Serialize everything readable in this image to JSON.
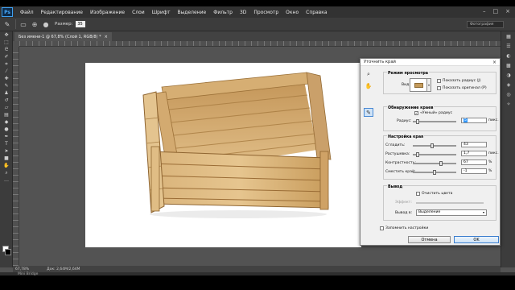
{
  "menubar": {
    "items": [
      "Файл",
      "Редактирование",
      "Изображение",
      "Слои",
      "Шрифт",
      "Выделение",
      "Фильтр",
      "3D",
      "Просмотр",
      "Окно",
      "Справка"
    ],
    "logo": "Ps"
  },
  "options_bar": {
    "size_label": "Размер:",
    "size_value": "35",
    "workspace": "Фотография"
  },
  "document": {
    "tab_title": "Без имени-1 @ 67,8% (Слой 1, RGB/8) *",
    "tab_close": "×"
  },
  "status_bar": {
    "zoom": "67,78%",
    "doc_info": "Док: 2,64M/2,64M",
    "mini_bridge": "Mini Bridge"
  },
  "dialog": {
    "title": "Уточнить край",
    "view_mode": {
      "group_title": "Режим просмотра",
      "view_label": "Вид:",
      "show_radius": "Показать радиус (J)",
      "show_original": "Показать оригинал (P)"
    },
    "edge_detection": {
      "group_title": "Обнаружение краев",
      "smart_radius": "«Умный» радиус",
      "smart_radius_checked": true,
      "radius_label": "Радиус:",
      "radius_value": "5",
      "radius_unit": "пикс.",
      "radius_fraction": 0.06
    },
    "adjust_edge": {
      "group_title": "Настройка края",
      "rows": [
        {
          "label": "Сгладить:",
          "value": "43",
          "unit": "",
          "fraction": 0.43
        },
        {
          "label": "Растушевка:",
          "value": "1,7",
          "unit": "пикс.",
          "fraction": 0.07
        },
        {
          "label": "Контрастность:",
          "value": "67",
          "unit": "%",
          "fraction": 0.67
        },
        {
          "label": "Сместить край:",
          "value": "-1",
          "unit": "%",
          "fraction": 0.49
        }
      ]
    },
    "output": {
      "group_title": "Вывод",
      "decontaminate": "Очистить цвета",
      "amount_label": "Эффект:",
      "output_to_label": "Вывод в:",
      "output_to_value": "Выделение"
    },
    "remember": "Запомнить настройки",
    "cancel": "Отмена",
    "ok": "OK"
  },
  "icons": {
    "tools": [
      "move-tool-icon",
      "marquee-tool-icon",
      "lasso-tool-icon",
      "quick-selection-tool-icon",
      "crop-tool-icon",
      "eyedropper-tool-icon",
      "healing-brush-icon",
      "brush-tool-icon",
      "clone-stamp-icon",
      "history-brush-icon",
      "eraser-tool-icon",
      "gradient-tool-icon",
      "blur-tool-icon",
      "dodge-tool-icon",
      "pen-tool-icon",
      "type-tool-icon",
      "path-selection-icon",
      "shape-tool-icon",
      "hand-tool-icon",
      "zoom-tool-icon",
      "quick-mask-icon",
      "screen-mode-icon"
    ]
  }
}
